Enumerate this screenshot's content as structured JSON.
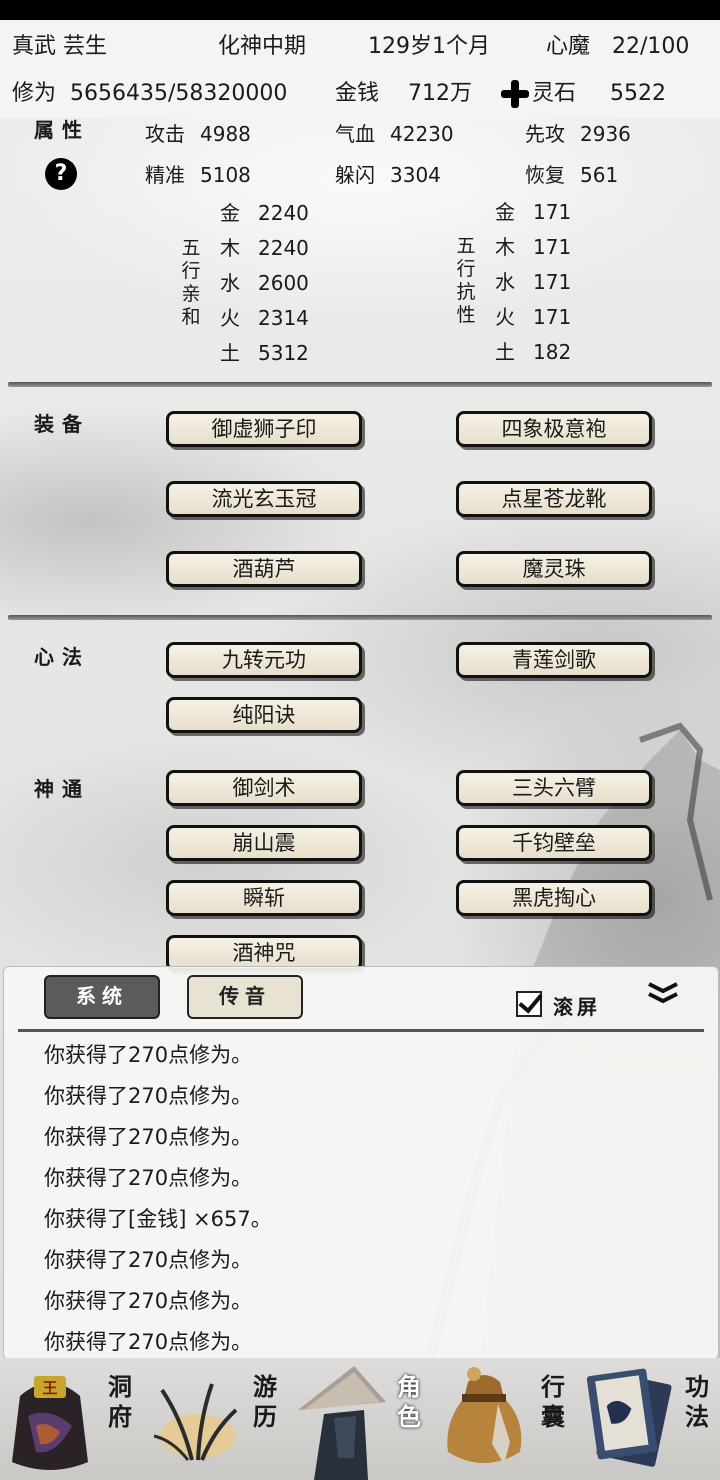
{
  "header": {
    "name": "真武 芸生",
    "realm": "化神中期",
    "age": "129岁1个月",
    "demon_label": "心魔",
    "demon_value": "22/100",
    "cultivation_label": "修为",
    "cultivation_value": "5656435/58320000",
    "money_label": "金钱",
    "money_value": "712万",
    "spirit_stone_label": "灵石",
    "spirit_stone_value": "5522"
  },
  "attributes": {
    "section_title": "属性",
    "help_label": "?",
    "stats": [
      {
        "label": "攻击",
        "value": "4988"
      },
      {
        "label": "气血",
        "value": "42230"
      },
      {
        "label": "先攻",
        "value": "2936"
      },
      {
        "label": "精准",
        "value": "5108"
      },
      {
        "label": "躲闪",
        "value": "3304"
      },
      {
        "label": "恢复",
        "value": "561"
      }
    ],
    "affinity_title": "五行亲和",
    "affinity": [
      {
        "label": "金",
        "value": "2240"
      },
      {
        "label": "木",
        "value": "2240"
      },
      {
        "label": "水",
        "value": "2600"
      },
      {
        "label": "火",
        "value": "2314"
      },
      {
        "label": "土",
        "value": "5312"
      }
    ],
    "resistance_title": "五行抗性",
    "resistance": [
      {
        "label": "金",
        "value": "171"
      },
      {
        "label": "木",
        "value": "171"
      },
      {
        "label": "水",
        "value": "171"
      },
      {
        "label": "火",
        "value": "171"
      },
      {
        "label": "土",
        "value": "182"
      }
    ]
  },
  "equipment": {
    "section_title": "装备",
    "items": [
      "御虚狮子印",
      "四象极意袍",
      "流光玄玉冠",
      "点星苍龙靴",
      "酒葫芦",
      "魔灵珠"
    ]
  },
  "methods": {
    "section_title": "心法",
    "items": [
      "九转元功",
      "青莲剑歌",
      "纯阳诀"
    ]
  },
  "skills": {
    "section_title": "神通",
    "items": [
      "御剑术",
      "三头六臂",
      "崩山震",
      "千钧壁垒",
      "瞬斩",
      "黑虎掏心",
      "酒神咒"
    ]
  },
  "log": {
    "tab_system": "系统",
    "tab_channel": "传音",
    "autoscroll_label": "滚屏",
    "autoscroll_checked": true,
    "collapse_icon": "double-chevron-down-icon",
    "lines": [
      "你获得了270点修为。",
      "你获得了270点修为。",
      "你获得了270点修为。",
      "你获得了270点修为。",
      "你获得了[金钱] ×657。",
      "你获得了270点修为。",
      "你获得了270点修为。",
      "你获得了270点修为。"
    ]
  },
  "nav": {
    "active": "角色",
    "items": [
      {
        "label": "洞府",
        "icon": "cave-bag-icon"
      },
      {
        "label": "游历",
        "icon": "grass-icon"
      },
      {
        "label": "角色",
        "icon": "straw-hat-icon"
      },
      {
        "label": "行囊",
        "icon": "sack-icon"
      },
      {
        "label": "功法",
        "icon": "books-icon"
      }
    ]
  }
}
